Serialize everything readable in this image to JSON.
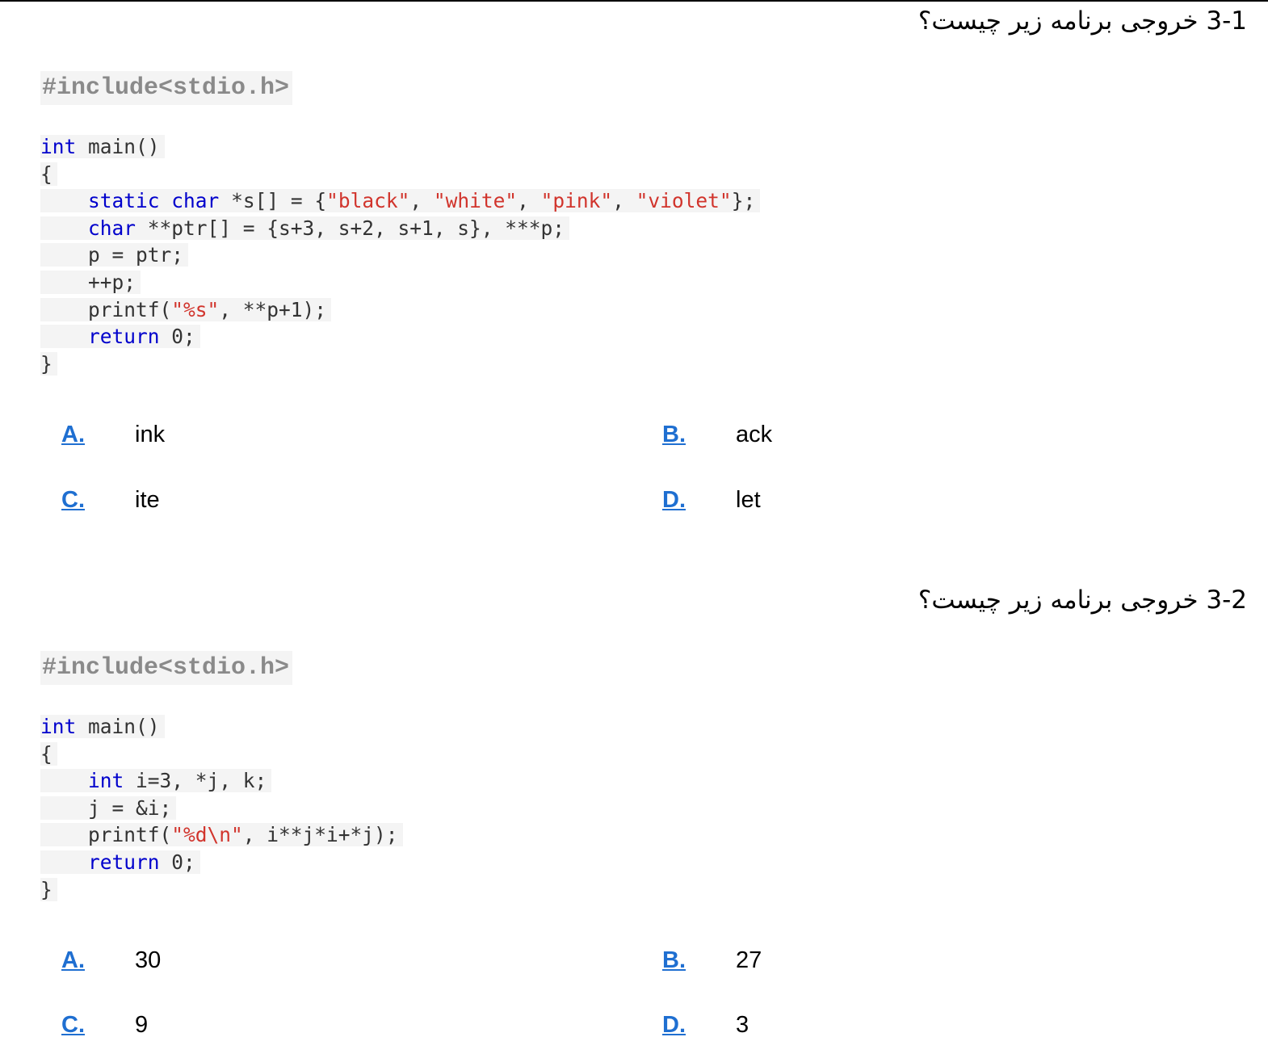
{
  "questions": [
    {
      "title": "3-1 خروجی برنامه زیر چیست؟",
      "include": "#include<stdio.h>",
      "code": [
        [
          {
            "t": "int",
            "c": "kw"
          },
          {
            "t": " main()"
          }
        ],
        [
          {
            "t": "{"
          }
        ],
        [
          {
            "t": "    "
          },
          {
            "t": "static",
            "c": "kw"
          },
          {
            "t": " "
          },
          {
            "t": "char",
            "c": "kw"
          },
          {
            "t": " *s[] = {"
          },
          {
            "t": "\"black\"",
            "c": "str"
          },
          {
            "t": ", "
          },
          {
            "t": "\"white\"",
            "c": "str"
          },
          {
            "t": ", "
          },
          {
            "t": "\"pink\"",
            "c": "str"
          },
          {
            "t": ", "
          },
          {
            "t": "\"violet\"",
            "c": "str"
          },
          {
            "t": "};"
          }
        ],
        [
          {
            "t": "    "
          },
          {
            "t": "char",
            "c": "kw"
          },
          {
            "t": " **ptr[] = {s+3, s+2, s+1, s}, ***p;"
          }
        ],
        [
          {
            "t": "    p = ptr;"
          }
        ],
        [
          {
            "t": "    ++p;"
          }
        ],
        [
          {
            "t": "    printf("
          },
          {
            "t": "\"%s\"",
            "c": "str"
          },
          {
            "t": ", **p+1);"
          }
        ],
        [
          {
            "t": "    "
          },
          {
            "t": "return",
            "c": "kw"
          },
          {
            "t": " 0;"
          }
        ],
        [
          {
            "t": "}"
          }
        ]
      ],
      "options": [
        {
          "label": "A.",
          "value": "ink"
        },
        {
          "label": "B.",
          "value": "ack"
        },
        {
          "label": "C.",
          "value": "ite"
        },
        {
          "label": "D.",
          "value": "let"
        }
      ]
    },
    {
      "title": "3-2 خروجی برنامه زیر چیست؟",
      "include": "#include<stdio.h>",
      "code": [
        [
          {
            "t": "int",
            "c": "kw"
          },
          {
            "t": " main()"
          }
        ],
        [
          {
            "t": "{"
          }
        ],
        [
          {
            "t": "    "
          },
          {
            "t": "int",
            "c": "kw"
          },
          {
            "t": " i=3, *j, k;"
          }
        ],
        [
          {
            "t": "    j = &i;"
          }
        ],
        [
          {
            "t": "    printf("
          },
          {
            "t": "\"%d\\n\"",
            "c": "str"
          },
          {
            "t": ", i**j*i+*j);"
          }
        ],
        [
          {
            "t": "    "
          },
          {
            "t": "return",
            "c": "kw"
          },
          {
            "t": " 0;"
          }
        ],
        [
          {
            "t": "}"
          }
        ]
      ],
      "options": [
        {
          "label": "A.",
          "value": "30"
        },
        {
          "label": "B.",
          "value": "27"
        },
        {
          "label": "C.",
          "value": "9"
        },
        {
          "label": "D.",
          "value": "3"
        }
      ]
    }
  ]
}
